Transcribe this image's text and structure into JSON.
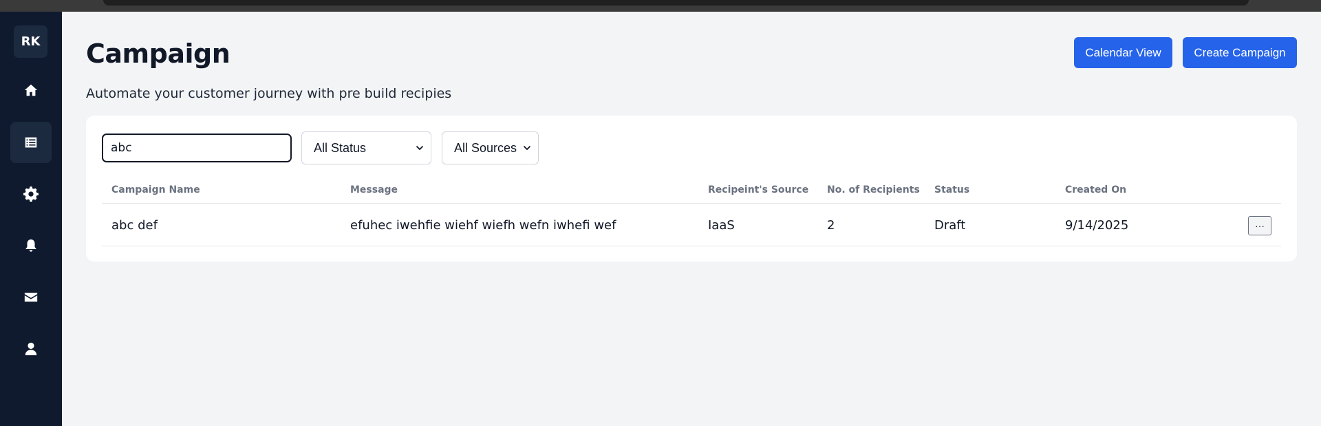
{
  "user": {
    "initials": "RK"
  },
  "nav": [
    {
      "icon": "home-icon",
      "active": false
    },
    {
      "icon": "list-icon",
      "active": true
    },
    {
      "icon": "gear-icon",
      "active": false
    },
    {
      "icon": "bell-icon",
      "active": false
    },
    {
      "icon": "envelope-icon",
      "active": false
    },
    {
      "icon": "user-icon",
      "active": false
    }
  ],
  "header": {
    "title": "Campaign",
    "subtitle": "Automate your customer journey with pre build recipies",
    "calendar_label": "Calendar View",
    "create_label": "Create Campaign"
  },
  "filters": {
    "search_value": "abc",
    "status_selected": "All Status",
    "source_selected": "All Sources"
  },
  "table": {
    "columns": [
      "Campaign Name",
      "Message",
      "Recipeint's Source",
      "No. of Recipients",
      "Status",
      "Created On"
    ],
    "rows": [
      {
        "name": "abc def",
        "message": "efuhec iwehfie wiehf wiefh wefn iwhefi wef",
        "source": "IaaS",
        "recipients": "2",
        "status": "Draft",
        "created": "9/14/2025",
        "actions_label": "···"
      }
    ]
  },
  "colors": {
    "sidebar": "#0f1a2e",
    "accent": "#2563eb",
    "background": "#f3f4f6"
  }
}
